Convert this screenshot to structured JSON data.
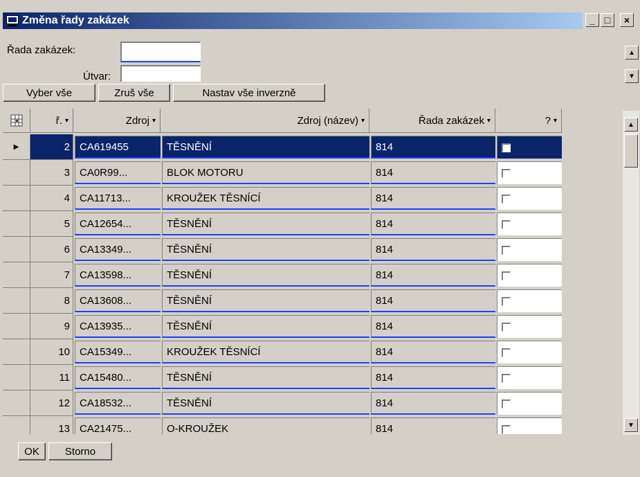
{
  "window": {
    "title": "Změna řady zakázek"
  },
  "controls": {
    "minimize": "_",
    "maximize": "□",
    "close": "×"
  },
  "form": {
    "rada_label": "Řada zakázek:",
    "rada_value": "",
    "utvar_label": "Útvar:",
    "utvar_value": ""
  },
  "toolbar": {
    "select_all": "Vyber vše",
    "deselect_all": "Zruš vše",
    "invert": "Nastav vše inverzně"
  },
  "grid": {
    "columns": [
      "ř.",
      "Zdroj",
      "Zdroj (název)",
      "Řada zakázek",
      "?"
    ],
    "rows": [
      {
        "n": "2",
        "zdroj": "CA619455",
        "nazev": "TĚSNĚNÍ",
        "rada": "814",
        "checked": false,
        "selected": true
      },
      {
        "n": "3",
        "zdroj": "CA0R99...",
        "nazev": "BLOK MOTORU",
        "rada": "814",
        "checked": false
      },
      {
        "n": "4",
        "zdroj": "CA11713...",
        "nazev": "KROUŽEK TĚSNÍCÍ",
        "rada": "814",
        "checked": false
      },
      {
        "n": "5",
        "zdroj": "CA12654...",
        "nazev": "TĚSNĚNÍ",
        "rada": "814",
        "checked": false
      },
      {
        "n": "6",
        "zdroj": "CA13349...",
        "nazev": "TĚSNĚNÍ",
        "rada": "814",
        "checked": false
      },
      {
        "n": "7",
        "zdroj": "CA13598...",
        "nazev": "TĚSNĚNÍ",
        "rada": "814",
        "checked": false
      },
      {
        "n": "8",
        "zdroj": "CA13608...",
        "nazev": "TĚSNĚNÍ",
        "rada": "814",
        "checked": false
      },
      {
        "n": "9",
        "zdroj": "CA13935...",
        "nazev": "TĚSNĚNÍ",
        "rada": "814",
        "checked": false
      },
      {
        "n": "10",
        "zdroj": "CA15349...",
        "nazev": "KROUŽEK TĚSNÍCÍ",
        "rada": "814",
        "checked": false
      },
      {
        "n": "11",
        "zdroj": "CA15480...",
        "nazev": "TĚSNĚNÍ",
        "rada": "814",
        "checked": false
      },
      {
        "n": "12",
        "zdroj": "CA18532...",
        "nazev": "TĚSNĚNÍ",
        "rada": "814",
        "checked": false
      },
      {
        "n": "13",
        "zdroj": "CA21475...",
        "nazev": "O-KROUŽEK",
        "rada": "814",
        "checked": false
      }
    ]
  },
  "footer": {
    "ok": "OK",
    "cancel": "Storno"
  }
}
